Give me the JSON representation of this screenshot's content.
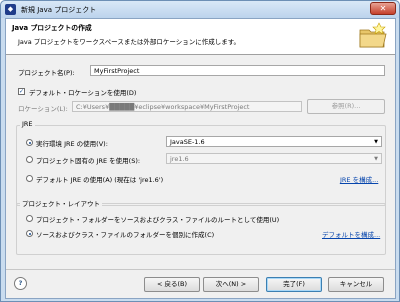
{
  "window": {
    "title": "新規 Java プロジェクト"
  },
  "banner": {
    "title": "Java プロジェクトの作成",
    "description": "Java プロジェクトをワークスペースまたは外部ロケーションに作成します。"
  },
  "project_name": {
    "label": "プロジェクト名(P):",
    "value": "MyFirstProject"
  },
  "use_default_location": {
    "label": "デフォルト・ロケーションを使用(D)",
    "checked": true
  },
  "location": {
    "label": "ロケーション(L):",
    "value": "C:¥Users¥█████¥eclipse¥workspace¥MyFirstProject",
    "browse_label": "参照(R)..."
  },
  "jre_group": {
    "title": "JRE",
    "option_execution_env": {
      "label": "実行環境 JRE の使用(V):",
      "selected": true
    },
    "execution_env_value": "JavaSE-1.6",
    "option_project_specific": {
      "label": "プロジェクト固有の JRE を使用(S):",
      "selected": false
    },
    "project_specific_value": "jre1.6",
    "option_default_jre": {
      "label": "デフォルト JRE の使用(A) (現在は 'jre1.6')",
      "selected": false
    },
    "configure_link": "JRE を構成..."
  },
  "layout_group": {
    "title": "プロジェクト・レイアウト",
    "option_root": {
      "label": "プロジェクト・フォルダーをソースおよびクラス・ファイルのルートとして使用(U)",
      "selected": false
    },
    "option_separate": {
      "label": "ソースおよびクラス・ファイルのフォルダーを個別に作成(C)",
      "selected": true
    },
    "configure_default_link": "デフォルトを構成..."
  },
  "footer": {
    "back_label": "< 戻る(B)",
    "next_label": "次へ(N) >",
    "finish_label": "完了(F)",
    "cancel_label": "キャンセル"
  }
}
